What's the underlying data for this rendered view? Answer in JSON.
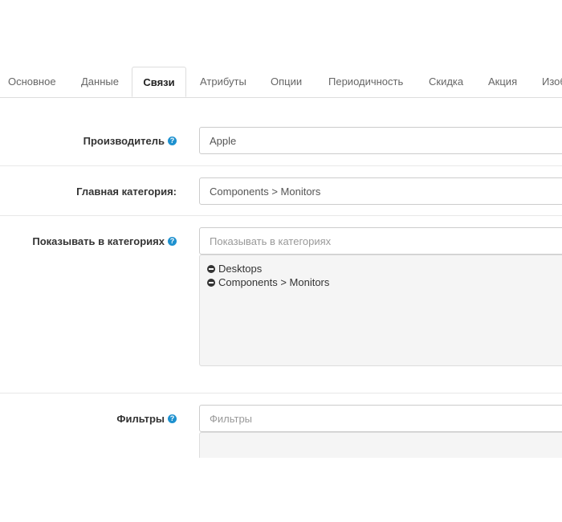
{
  "tabs": [
    {
      "label": "Основное"
    },
    {
      "label": "Данные"
    },
    {
      "label": "Связи"
    },
    {
      "label": "Атрибуты"
    },
    {
      "label": "Опции"
    },
    {
      "label": "Периодичность"
    },
    {
      "label": "Скидка"
    },
    {
      "label": "Акция"
    },
    {
      "label": "Изображения"
    }
  ],
  "active_tab": "Связи",
  "form": {
    "manufacturer": {
      "label": "Производитель",
      "value": "Apple"
    },
    "main_category": {
      "label": "Главная категория:",
      "value": "Components > Monitors"
    },
    "categories": {
      "label": "Показывать в категориях",
      "placeholder": "Показывать в категориях",
      "items": [
        {
          "label": "Desktops"
        },
        {
          "label": "Components > Monitors"
        }
      ]
    },
    "filters": {
      "label": "Фильтры",
      "placeholder": "Фильтры"
    }
  },
  "icons": {
    "help": "help-icon",
    "remove": "minus-circle-icon"
  },
  "colors": {
    "help_icon": "#1e91cf",
    "well_bg": "#f5f5f5"
  }
}
